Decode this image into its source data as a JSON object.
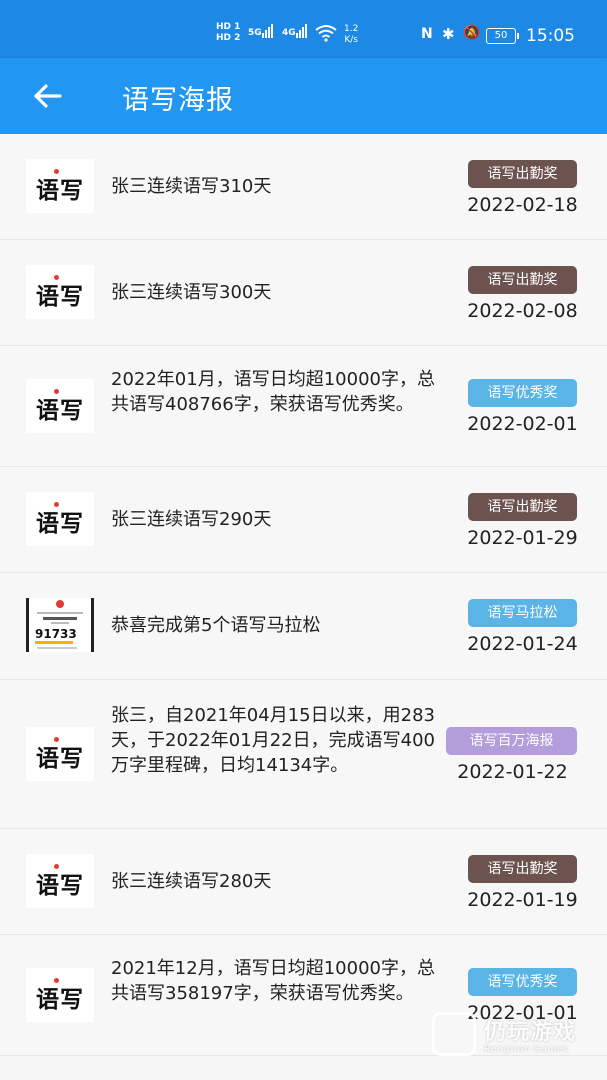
{
  "status_bar": {
    "hd1": "HD 1",
    "hd2": "HD 2",
    "sig1": "5G",
    "sig2": "4G",
    "speed_value": "1.2",
    "speed_unit": "K/s",
    "nfc": "N",
    "bluetooth": "✱",
    "mute": "🔕",
    "battery": "50",
    "time": "15:05"
  },
  "app_bar": {
    "back_icon": "arrow-left-icon",
    "title": "语写海报"
  },
  "items": [
    {
      "thumb": "语写",
      "text": "张三连续语写310天",
      "badge": "语写出勤奖",
      "badge_color": "#6d5350",
      "date": "2022-02-18"
    },
    {
      "thumb": "语写",
      "text": "张三连续语写300天",
      "badge": "语写出勤奖",
      "badge_color": "#6d5350",
      "date": "2022-02-08"
    },
    {
      "thumb": "语写",
      "text": "2022年01月，语写日均超10000字，总共语写408766字，荣获语写优秀奖。",
      "badge": "语写优秀奖",
      "badge_color": "#5ab4e6",
      "date": "2022-02-01"
    },
    {
      "thumb": "语写",
      "text": "张三连续语写290天",
      "badge": "语写出勤奖",
      "badge_color": "#6d5350",
      "date": "2022-01-29"
    },
    {
      "thumb": "91733",
      "text": "恭喜完成第5个语写马拉松",
      "badge": "语写马拉松",
      "badge_color": "#5ab4e6",
      "date": "2022-01-24"
    },
    {
      "thumb": "语写",
      "text": "张三，自2021年04月15日以来，用283天，于2022年01月22日，完成语写400万字里程碑，日均14134字。",
      "badge": "语写百万海报",
      "badge_color": "#b39ddb",
      "date": "2022-01-22"
    },
    {
      "thumb": "语写",
      "text": "张三连续语写280天",
      "badge": "语写出勤奖",
      "badge_color": "#6d5350",
      "date": "2022-01-19"
    },
    {
      "thumb": "语写",
      "text": "2021年12月，语写日均超10000字，总共语写358197字，荣获语写优秀奖。",
      "badge": "语写优秀奖",
      "badge_color": "#5ab4e6",
      "date": "2022-01-01"
    }
  ],
  "watermark": {
    "name": "仍玩游戏",
    "sub": "Rengwan Games"
  }
}
